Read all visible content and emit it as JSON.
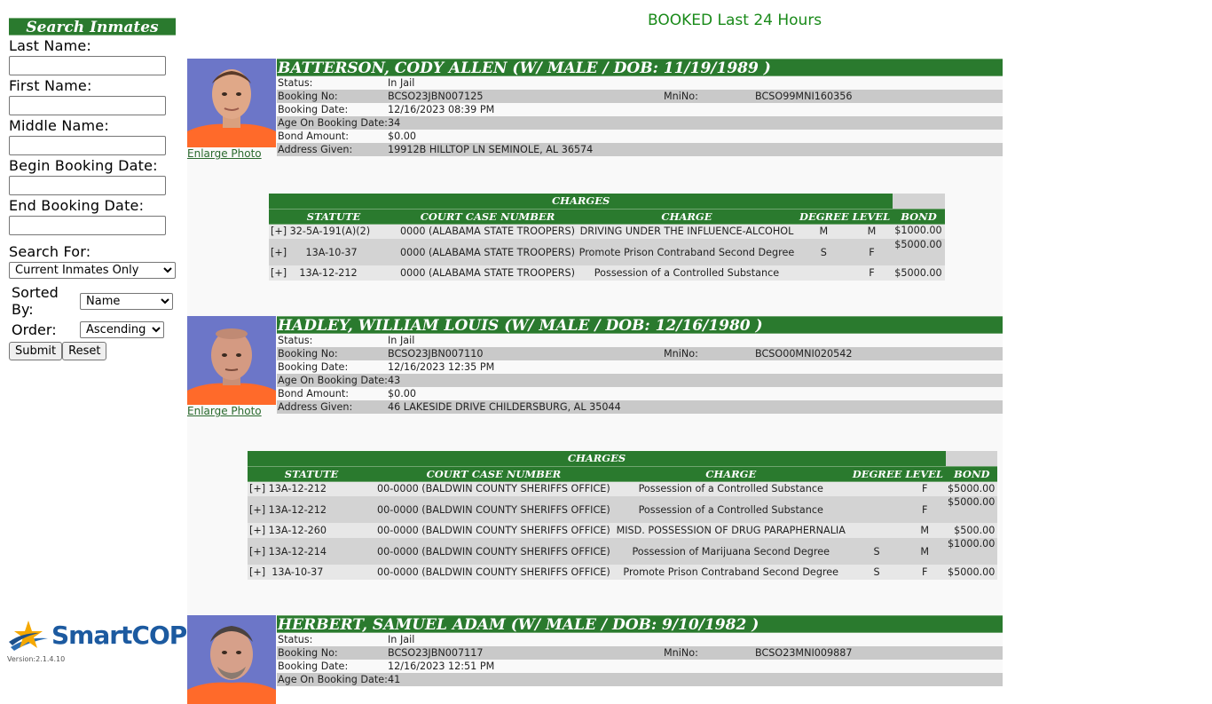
{
  "search": {
    "title": "Search Inmates",
    "last_name_label": "Last Name:",
    "first_name_label": "First Name:",
    "middle_name_label": "Middle Name:",
    "begin_booking_label": "Begin Booking Date:",
    "end_booking_label": "End Booking Date:",
    "search_for_label": "Search For:",
    "search_for_value": "Current Inmates Only",
    "sorted_by_label": "Sorted By:",
    "sorted_by_value": "Name",
    "order_label": "Order:",
    "order_value": "Ascending",
    "submit_label": "Submit",
    "reset_label": "Reset"
  },
  "footer": {
    "logo_text": "SmartCOP",
    "version": "Version:2.1.4.10"
  },
  "page_title": "BOOKED Last 24 Hours",
  "common": {
    "status_label": "Status:",
    "booking_no_label": "Booking No:",
    "mnino_label": "MniNo:",
    "booking_date_label": "Booking Date:",
    "age_label": "Age On Booking Date:",
    "bond_amount_label": "Bond Amount:",
    "address_label": "Address Given:",
    "enlarge_photo": "Enlarge Photo",
    "charges_title": "CHARGES",
    "col_statute": "STATUTE",
    "col_court_case": "COURT CASE NUMBER",
    "col_charge": "CHARGE",
    "col_degree": "DEGREE",
    "col_level": "LEVEL",
    "col_bond": "BOND"
  },
  "inmates": [
    {
      "name": "BATTERSON, CODY ALLEN   (W/ MALE / DOB: 11/19/1989 )",
      "status": "In Jail",
      "booking_no": "BCSO23JBN007125",
      "mnino": "BCSO99MNI160356",
      "booking_date": "12/16/2023 08:39 PM",
      "age": "34",
      "bond_amount": "$0.00",
      "address": "19912B HILLTOP LN SEMINOLE, AL 36574",
      "charges": [
        {
          "expand": "[+]",
          "statute": "32-5A-191(A)(2)",
          "court_case": "0000 (ALABAMA STATE TROOPERS)",
          "charge": "DRIVING UNDER THE INFLUENCE-ALCOHOL",
          "degree": "M",
          "level": "M",
          "bond": "$1000.00"
        },
        {
          "expand": "[+]",
          "statute": "13A-10-37",
          "court_case": "0000 (ALABAMA STATE TROOPERS)",
          "charge": "Promote Prison Contraband Second Degree",
          "degree": "S",
          "level": "F",
          "bond": "$5000.00"
        },
        {
          "expand": "[+]",
          "statute": "13A-12-212",
          "court_case": "0000 (ALABAMA STATE TROOPERS)",
          "charge": "Possession of a Controlled Substance",
          "degree": "",
          "level": "F",
          "bond": "$5000.00"
        }
      ]
    },
    {
      "name": "HADLEY, WILLIAM LOUIS   (W/ MALE / DOB: 12/16/1980 )",
      "status": "In Jail",
      "booking_no": "BCSO23JBN007110",
      "mnino": "BCSO00MNI020542",
      "booking_date": "12/16/2023 12:35 PM",
      "age": "43",
      "bond_amount": "$0.00",
      "address": "46 LAKESIDE DRIVE CHILDERSBURG, AL 35044",
      "charges": [
        {
          "expand": "[+]",
          "statute": "13A-12-212",
          "court_case": "00-0000 (BALDWIN COUNTY SHERIFFS OFFICE)",
          "charge": "Possession of a Controlled Substance",
          "degree": "",
          "level": "F",
          "bond": "$5000.00"
        },
        {
          "expand": "[+]",
          "statute": "13A-12-212",
          "court_case": "00-0000 (BALDWIN COUNTY SHERIFFS OFFICE)",
          "charge": "Possession of a Controlled Substance",
          "degree": "",
          "level": "F",
          "bond": "$5000.00"
        },
        {
          "expand": "[+]",
          "statute": "13A-12-260",
          "court_case": "00-0000 (BALDWIN COUNTY SHERIFFS OFFICE)",
          "charge": "MISD. POSSESSION OF DRUG PARAPHERNALIA",
          "degree": "",
          "level": "M",
          "bond": "$500.00"
        },
        {
          "expand": "[+]",
          "statute": "13A-12-214",
          "court_case": "00-0000 (BALDWIN COUNTY SHERIFFS OFFICE)",
          "charge": "Possession of Marijuana Second Degree",
          "degree": "S",
          "level": "M",
          "bond": "$1000.00"
        },
        {
          "expand": "[+]",
          "statute": "13A-10-37",
          "court_case": "00-0000 (BALDWIN COUNTY SHERIFFS OFFICE)",
          "charge": "Promote Prison Contraband Second Degree",
          "degree": "S",
          "level": "F",
          "bond": "$5000.00"
        }
      ]
    },
    {
      "name": "HERBERT, SAMUEL ADAM   (W/ MALE / DOB: 9/10/1982 )",
      "status": "In Jail",
      "booking_no": "BCSO23JBN007117",
      "mnino": "BCSO23MNI009887",
      "booking_date": "12/16/2023 12:51 PM",
      "age": "41"
    }
  ]
}
